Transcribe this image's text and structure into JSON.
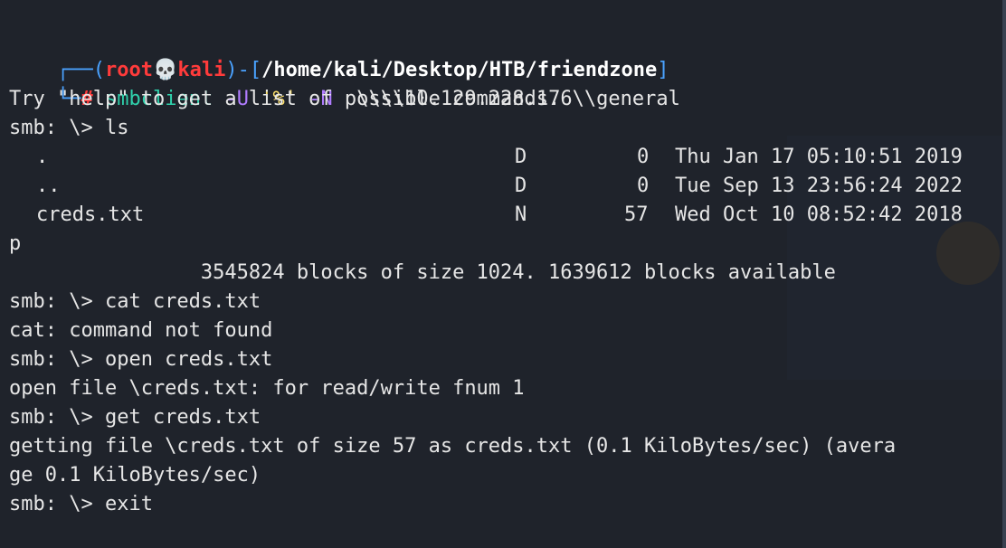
{
  "prompt": {
    "open_bracket": "┌──(",
    "user": "root",
    "skull": "💀",
    "host": "kali",
    "close_bracket_path": ")-[",
    "path": "/home/kali/Desktop/HTB/friendzone",
    "close_path": "]",
    "second_prefix": "└─",
    "hash": "#",
    "cmd": "smbclient",
    "flag_u": "-U",
    "user_arg": "'%'",
    "flag_n": "-N",
    "share": "\\\\\\\\10.129.228.176\\\\general"
  },
  "lines": {
    "help": "Try \"help\" to get a list of possible commands.",
    "ls_cmd": "smb: \\> ls",
    "blocks": "                3545824 blocks of size 1024. 1639612 blocks available",
    "cat_cmd": "smb: \\> cat creds.txt",
    "cat_err": "cat: command not found",
    "open_cmd": "smb: \\> open creds.txt",
    "open_out": "open file \\creds.txt: for read/write fnum 1",
    "get_cmd": "smb: \\> get creds.txt",
    "get_out1": "getting file \\creds.txt of size 57 as creds.txt (0.1 KiloBytes/sec) (avera",
    "get_out2": "ge 0.1 KiloBytes/sec)",
    "exit_cmd": "smb: \\> exit",
    "p_line": "p"
  },
  "ls_rows": [
    {
      "name": ".",
      "type": "D",
      "size": "0",
      "date": "Thu Jan 17 05:10:51 2019"
    },
    {
      "name": "..",
      "type": "D",
      "size": "0",
      "date": "Tue Sep 13 23:56:24 2022"
    },
    {
      "name": "creds.txt",
      "type": "N",
      "size": "57",
      "date": "Wed Oct 10 08:52:42 2018"
    }
  ]
}
